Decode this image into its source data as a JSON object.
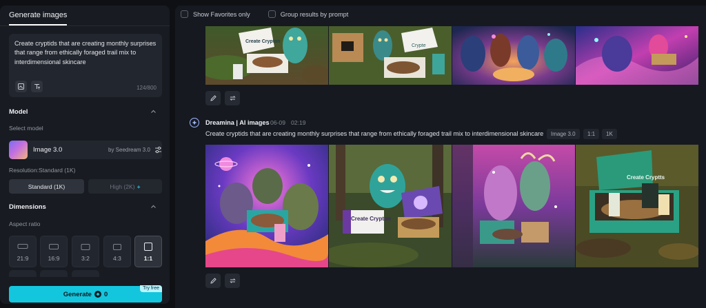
{
  "panel": {
    "tab_label": "Generate images",
    "prompt_text": "Create cryptids that are creating monthly surprises that range from ethically foraged trail mix to interdimensional skincare",
    "char_count": "124/800",
    "model_section_title": "Model",
    "select_model_label": "Select model",
    "model_name": "Image 3.0",
    "model_by": "by Seedream 3.0",
    "resolution_label": "Resolution:Standard (1K)",
    "res_standard": "Standard (1K)",
    "res_high": "High (2K)",
    "res_high_plus": "+",
    "dimensions_title": "Dimensions",
    "aspect_label": "Aspect ratio",
    "ratios": [
      "21:9",
      "16:9",
      "3:2",
      "4:3",
      "1:1"
    ],
    "selected_ratio": "1:1",
    "generate_label": "Generate",
    "generate_cost": "0",
    "try_free": "Try free"
  },
  "filters": {
    "show_favorites": "Show Favorites only",
    "group_by_prompt": "Group results by prompt"
  },
  "generation": {
    "author": "Dreamina | AI images",
    "date": "06-09",
    "time": "02:19",
    "prompt": "Create cryptids that are creating monthly surprises that range from ethically foraged trail mix to interdimensional skincare",
    "tags": [
      "Image 3.0",
      "1:1",
      "1K"
    ]
  },
  "box_labels": {
    "top_1": "Create Crypton",
    "top_2": "Crypte",
    "bottom_2": "Create Crypton",
    "bottom_4": "Create Cryptts"
  },
  "colors": {
    "accent": "#13c6de",
    "background": "#0e1014",
    "panel": "#181b21"
  },
  "icons": [
    "edit-icon",
    "regenerate-icon",
    "image-ref-icon",
    "text-style-icon",
    "settings-sliders-icon",
    "chevron-up-icon",
    "dreamina-logo-icon"
  ]
}
